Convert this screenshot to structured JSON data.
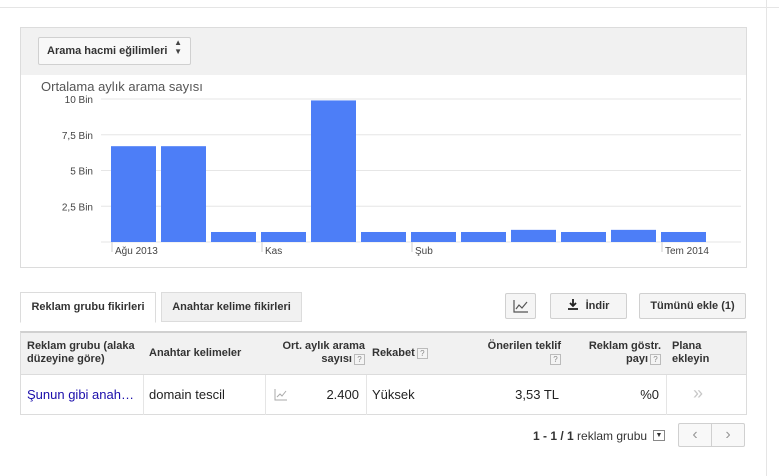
{
  "trend_select": {
    "label": "Arama hacmi eğilimleri"
  },
  "chart_data": {
    "type": "bar",
    "title": "Ortalama aylık arama sayısı",
    "y_ticks": [
      "2,5 Bin",
      "5 Bin",
      "7,5 Bin",
      "10 Bin"
    ],
    "ylim": [
      0,
      10000
    ],
    "x_tick_labels": [
      {
        "index": 0,
        "label": "Ağu 2013"
      },
      {
        "index": 3,
        "label": "Kas"
      },
      {
        "index": 6,
        "label": "Şub"
      },
      {
        "index": 11,
        "label": "Tem 2014"
      }
    ],
    "values": [
      6700,
      6700,
      700,
      700,
      9900,
      700,
      700,
      700,
      850,
      700,
      850,
      700
    ],
    "bar_color": "#4d7ef7",
    "grid": true
  },
  "tabs": {
    "active": "Reklam grubu fikirleri",
    "inactive": "Anahtar kelime fikirleri"
  },
  "toolbar": {
    "download_label": "İndir",
    "add_all_label": "Tümünü ekle (1)"
  },
  "table": {
    "headers": {
      "group": "Reklam grubu (alaka düzeyine göre)",
      "keywords": "Anahtar kelimeler",
      "avg": "Ort. aylık arama sayısı",
      "competition": "Rekabet",
      "bid": "Önerilen teklif",
      "share": "Reklam göstr. payı",
      "plan": "Plana ekleyin"
    },
    "row": {
      "group": "Şunun gibi anah…",
      "keywords": "domain tescil",
      "avg": "2.400",
      "competition": "Yüksek",
      "bid": "3,53 TL",
      "share": "%0"
    }
  },
  "pager": {
    "range": "1 - 1 / 1",
    "unit": "reklam grubu"
  }
}
